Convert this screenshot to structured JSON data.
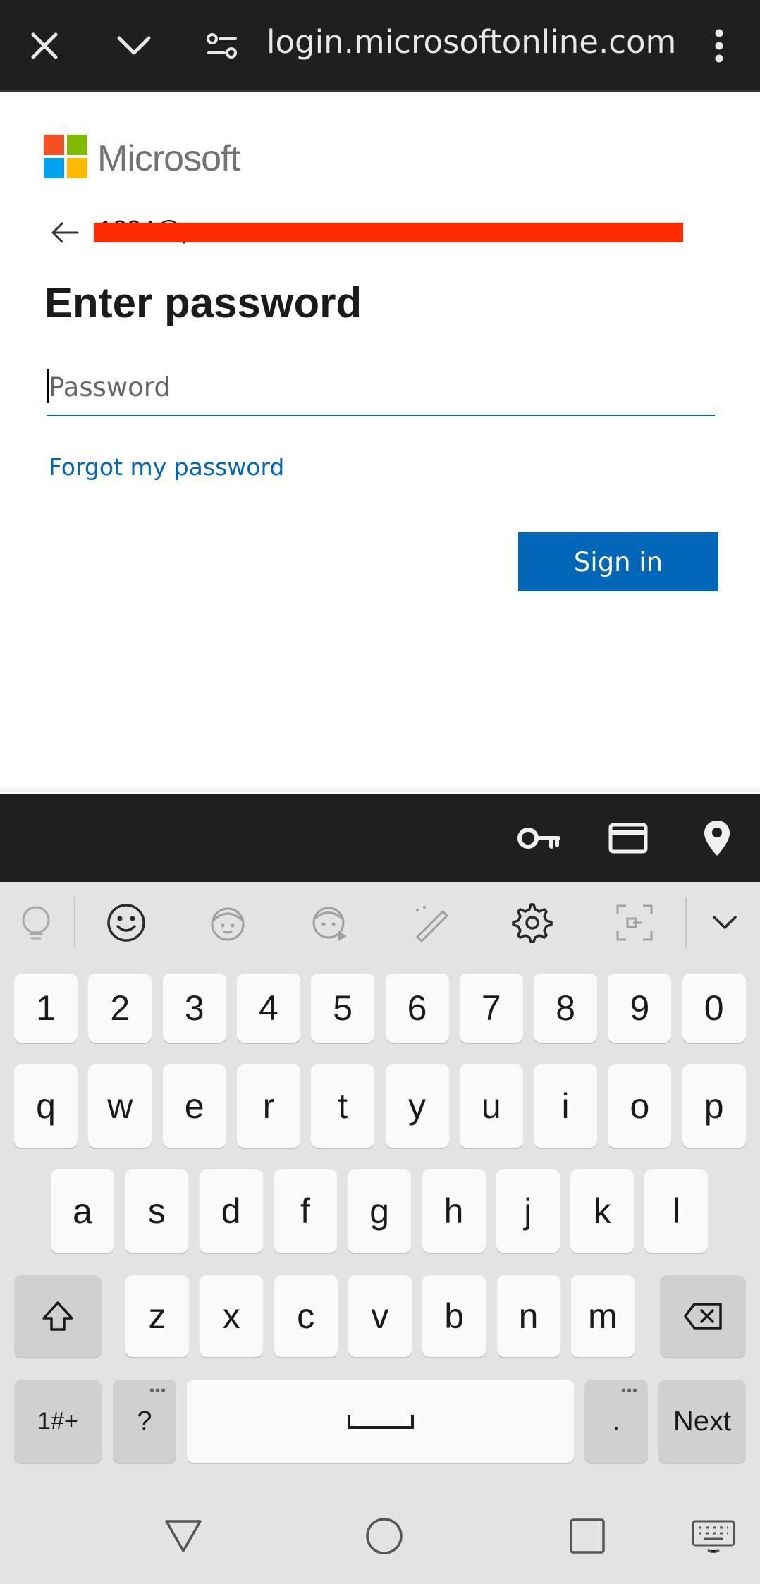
{
  "browser": {
    "url": "login.microsoftonline.com"
  },
  "page": {
    "brand": "Microsoft",
    "email_visible_fragment": "1234@p……………………………….com",
    "heading": "Enter password",
    "password_placeholder": "Password",
    "password_value": "",
    "forgot_link": "Forgot my password",
    "signin_label": "Sign in"
  },
  "colors": {
    "accent": "#0067b8",
    "redaction": "#ff2a00",
    "ms_red": "#f25022",
    "ms_green": "#7fba00",
    "ms_blue": "#00a4ef",
    "ms_yellow": "#ffb900"
  },
  "autofill_icons": [
    "key-icon",
    "card-icon",
    "location-pin-icon"
  ],
  "keyboard": {
    "toolbar_icons": [
      "translate-icon",
      "emoji-icon",
      "sticker-icon",
      "animated-sticker-icon",
      "handwriting-icon",
      "settings-icon",
      "screen-capture-icon",
      "collapse-chevron-icon"
    ],
    "row_numbers": [
      "1",
      "2",
      "3",
      "4",
      "5",
      "6",
      "7",
      "8",
      "9",
      "0"
    ],
    "row_top": [
      "q",
      "w",
      "e",
      "r",
      "t",
      "y",
      "u",
      "i",
      "o",
      "p"
    ],
    "row_mid": [
      "a",
      "s",
      "d",
      "f",
      "g",
      "h",
      "j",
      "k",
      "l"
    ],
    "row_bottom": [
      "z",
      "x",
      "c",
      "v",
      "b",
      "n",
      "m"
    ],
    "symbols_key": "1#+",
    "question_key": "?",
    "period_key": ".",
    "next_key": "Next"
  },
  "nav_icons": [
    "back-triangle-icon",
    "home-circle-icon",
    "recents-square-icon",
    "keyboard-switch-icon"
  ]
}
